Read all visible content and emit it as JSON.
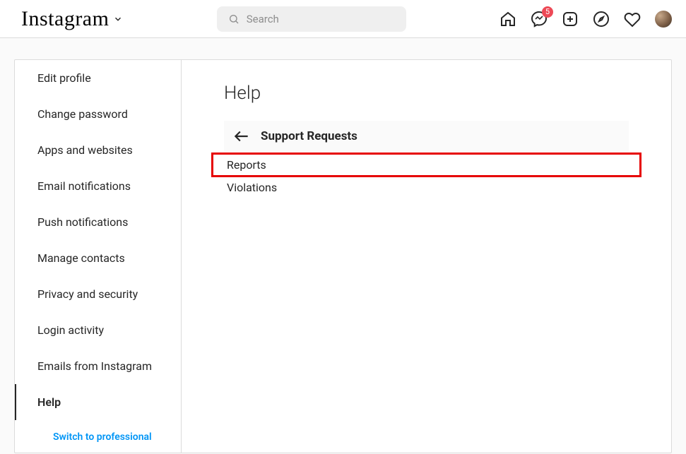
{
  "header": {
    "logo_text": "Instagram",
    "search_placeholder": "Search",
    "messenger_badge": "5"
  },
  "sidebar": {
    "items": [
      {
        "label": "Edit profile",
        "active": false
      },
      {
        "label": "Change password",
        "active": false
      },
      {
        "label": "Apps and websites",
        "active": false
      },
      {
        "label": "Email notifications",
        "active": false
      },
      {
        "label": "Push notifications",
        "active": false
      },
      {
        "label": "Manage contacts",
        "active": false
      },
      {
        "label": "Privacy and security",
        "active": false
      },
      {
        "label": "Login activity",
        "active": false
      },
      {
        "label": "Emails from Instagram",
        "active": false
      },
      {
        "label": "Help",
        "active": true
      }
    ],
    "switch_professional": "Switch to professional"
  },
  "main": {
    "title": "Help",
    "subheader": "Support Requests",
    "options": [
      {
        "label": "Reports",
        "highlighted": true
      },
      {
        "label": "Violations",
        "highlighted": false
      }
    ]
  }
}
